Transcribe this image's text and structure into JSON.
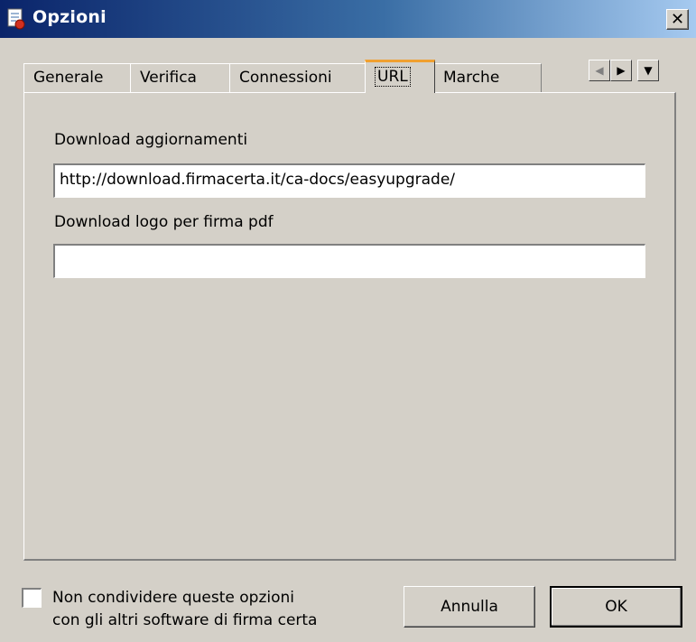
{
  "window": {
    "title": "Opzioni",
    "close_glyph": "✕",
    "icon": "document-seal-icon"
  },
  "tabs": [
    {
      "label": "Generale",
      "active": false
    },
    {
      "label": "Verifica",
      "active": false
    },
    {
      "label": "Connessioni",
      "active": false
    },
    {
      "label": "URL",
      "active": true
    },
    {
      "label": "Marche",
      "active": false
    }
  ],
  "tab_scroll": {
    "left": "◀",
    "right": "▶",
    "menu": "▼"
  },
  "panel": {
    "updates_label": "Download aggiornamenti",
    "updates_value": "http://download.firmacerta.it/ca-docs/easyupgrade/",
    "logo_label": "Download logo per firma pdf",
    "logo_value": ""
  },
  "footer": {
    "no_share_line1": "Non condividere queste opzioni",
    "no_share_line2": "con gli altri software di firma certa",
    "no_share_checked": false,
    "cancel_label": "Annulla",
    "ok_label": "OK"
  },
  "colors": {
    "titlebar_start": "#0a246a",
    "titlebar_end": "#a6caf0",
    "face": "#d4d0c8",
    "active_tab_accent": "#f0a030"
  }
}
